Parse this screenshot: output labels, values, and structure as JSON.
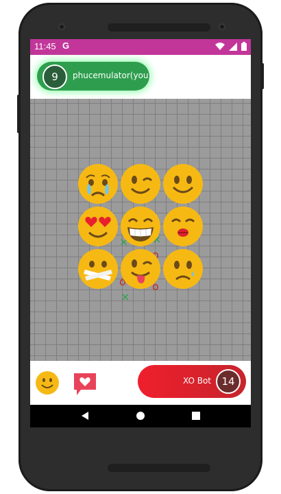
{
  "status_bar": {
    "time": "11:45",
    "g_icon": "G",
    "icons": [
      "wifi-icon",
      "signal-icon",
      "battery-icon"
    ],
    "bg_color": "#c2369a"
  },
  "player": {
    "badge_value": "9",
    "name": "phucemulator(you)",
    "color": "#2e9e4e"
  },
  "emoji_picker": {
    "items": [
      "crying-face",
      "winking-face",
      "smiling-face",
      "heart-eyes-face",
      "grinning-face",
      "kissing-face",
      "taped-mouth-face",
      "tongue-out-face",
      "sad-tear-face"
    ]
  },
  "board_marks": {
    "x_symbol": "×",
    "o_symbol": "o"
  },
  "opponent": {
    "name": "XO Bot",
    "badge_value": "14",
    "color": "#e8202c"
  },
  "bottom_actions": {
    "emoji_button": "smiley-icon",
    "heart_button": "heart-message-icon"
  },
  "nav": {
    "back": "back-icon",
    "home": "home-icon",
    "recents": "recents-icon"
  }
}
